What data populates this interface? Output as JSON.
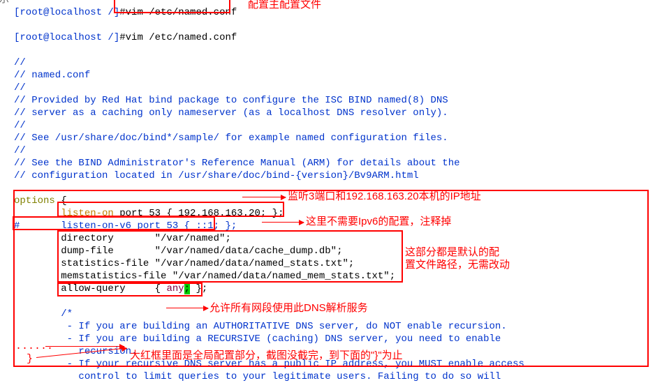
{
  "prompt": {
    "userhost": "[root@localhost /]",
    "hash": "#",
    "cmd1": "vim /etc/named.conf",
    "truncated_prev": "vim /etc/named.conf"
  },
  "annotations": {
    "main_conf": "配置主配置文件",
    "listen_on": "监听3端口和192.168.163.20本机的IP地址",
    "ipv6": "这里不需要Ipv6的配置，注释掉",
    "defaults1": "这部分都是默认的配",
    "defaults2": "置文件路径，无需改动",
    "allow_query": "允许所有网段使用此DNS解析服务",
    "global_end": "大红框里面是全局配置部分，截图没截完，到下面的\"}\"为止"
  },
  "file": {
    "c00": "//",
    "c01": "// named.conf",
    "c02": "//",
    "c03": "// Provided by Red Hat bind package to configure the ISC BIND named(8) DNS",
    "c04": "// server as a caching only nameserver (as a localhost DNS resolver only).",
    "c05": "//",
    "c06": "// See /usr/share/doc/bind*/sample/ for example named configuration files.",
    "c07": "//",
    "c08": "// See the BIND Administrator's Reference Manual (ARM) for details about the",
    "c09": "// configuration located in /usr/share/doc/bind-{version}/Bv9ARM.html",
    "options_kw": "options",
    "options_brace": " {",
    "listen_kw": "listen-on",
    "listen_rest": " port 53 { 192.168.163.20; };",
    "hash_col": "#",
    "listen6_kw": "listen-on-v6",
    "listen6_rest": " port 53 { ::1; };",
    "directory": "        directory       \"/var/named\";",
    "dump": "        dump-file       \"/var/named/data/cache_dump.db\";",
    "stats": "        statistics-file \"/var/named/data/named_stats.txt\";",
    "memstats": "        memstatistics-file \"/var/named/data/named_mem_stats.txt\";",
    "allow_pre": "        allow-query     { ",
    "allow_any": "any;",
    "allow_post": " };",
    "cm_open": "        /*",
    "cm_l1": "         - If you are building an AUTHORITATIVE DNS server, do NOT enable recursion.",
    "cm_l2": "         - If you are building a RECURSIVE (caching) DNS server, you need to enable",
    "cm_l3a": "           recursion.",
    "cm_l4": "         - If your recursive DNS server has a public IP address, you MUST enable access",
    "cm_l5": "           control to limit queries to your legitimate users. Failing to do so will"
  },
  "closing_brace": "}",
  "dots": "......",
  "side_char": "示"
}
